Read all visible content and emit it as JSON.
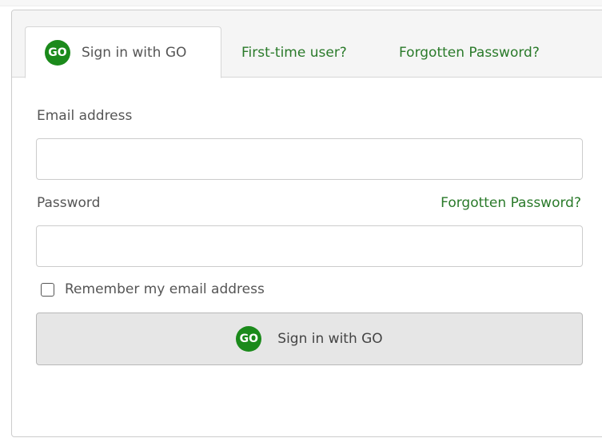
{
  "tabs": {
    "signin": {
      "label": "Sign in with GO",
      "badge": "GO"
    },
    "first_time": {
      "label": "First-time user?"
    },
    "forgotten": {
      "label": "Forgotten Password?"
    }
  },
  "form": {
    "email_label": "Email address",
    "email_value": "",
    "password_label": "Password",
    "password_value": "",
    "forgot_link": "Forgotten Password?",
    "remember_label": "Remember my email address",
    "remember_checked": false,
    "submit_label": "Sign in with GO",
    "submit_badge": "GO"
  },
  "colors": {
    "brand_green": "#1b8a1b",
    "link_green": "#2a7a2a"
  }
}
